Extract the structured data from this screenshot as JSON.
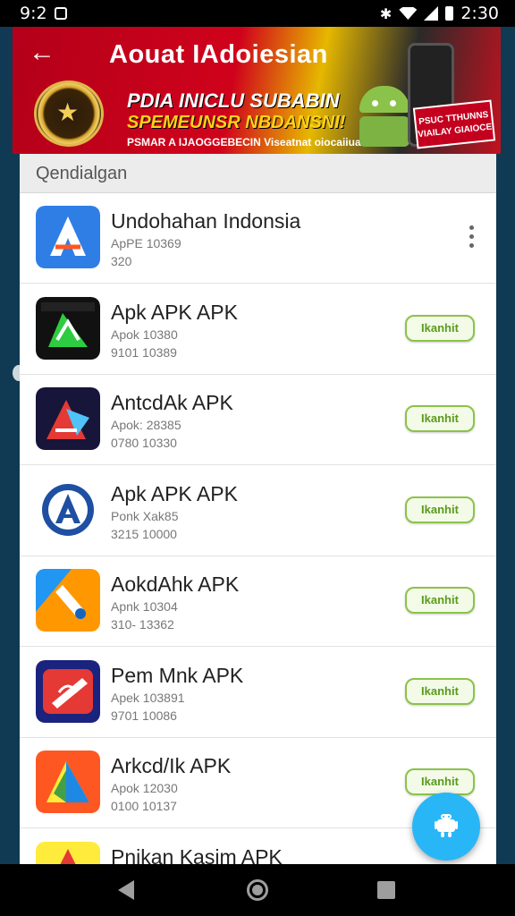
{
  "status_bar": {
    "time_left": "9:2",
    "time_right": "2:30"
  },
  "banner": {
    "title": "Aouat IAdoiesian",
    "line1": "PDIA INICLU SUBABIN",
    "line2": "SPEMEUNSR NBDANSNI!",
    "line3": "PSMAR A IJAOGGEBECIN Viseatnat oiocaiiual",
    "promo": "PSUC TTHUNNS VIAILAY GIAIOCE"
  },
  "list": {
    "header": "Qendialgan",
    "install_label": "Ikanhit",
    "items": [
      {
        "name": "Undohahan Indonsia",
        "sub1": "ApPE 10369",
        "sub2": "320",
        "action": "menu",
        "icon": "app-a-logo-icon",
        "icon_colors": [
          "#2f7ee6",
          "#ff5722"
        ]
      },
      {
        "name": "Apk APK APK",
        "sub1": "Apok 10380",
        "sub2": "9101 10389",
        "action": "install",
        "icon": "apk-maker-icon",
        "icon_colors": [
          "#111111",
          "#2ecc40"
        ]
      },
      {
        "name": "AntcdAk APK",
        "sub1": "Apok: 28385",
        "sub2": "0780 10330",
        "action": "install",
        "icon": "triangle-tool-icon",
        "icon_colors": [
          "#17153a",
          "#e53935"
        ]
      },
      {
        "name": "Apk APK APK",
        "sub1": "Ponk Xak85",
        "sub2": "3215 10000",
        "action": "install",
        "icon": "app-store-icon",
        "icon_colors": [
          "#ffffff",
          "#1e4fa3"
        ]
      },
      {
        "name": "AokdAhk APK",
        "sub1": "Apnk 10304",
        "sub2": "310- 13362",
        "action": "install",
        "icon": "pen-tool-icon",
        "icon_colors": [
          "#2196f3",
          "#ff9800"
        ]
      },
      {
        "name": "Pem Mnk APK",
        "sub1": "Apek 103891",
        "sub2": "9701 10086",
        "action": "install",
        "icon": "pencil-app-icon",
        "icon_colors": [
          "#1a237e",
          "#e53935"
        ]
      },
      {
        "name": "Arkcd/Ik APK",
        "sub1": "Apok 12030",
        "sub2": "0100 10137",
        "action": "install",
        "icon": "prism-app-icon",
        "icon_colors": [
          "#ff5722",
          "#1e88e5"
        ]
      },
      {
        "name": "Pnikan Kasim APK",
        "sub1": "",
        "sub2": "",
        "action": "none",
        "icon": "triangle-red-icon",
        "icon_colors": [
          "#1a237e",
          "#e53935"
        ]
      }
    ]
  },
  "fab": {
    "icon": "android-robot-icon",
    "color": "#29b6f6"
  },
  "nav": {
    "back": "back-icon",
    "home": "home-icon",
    "recent": "recent-apps-icon"
  }
}
